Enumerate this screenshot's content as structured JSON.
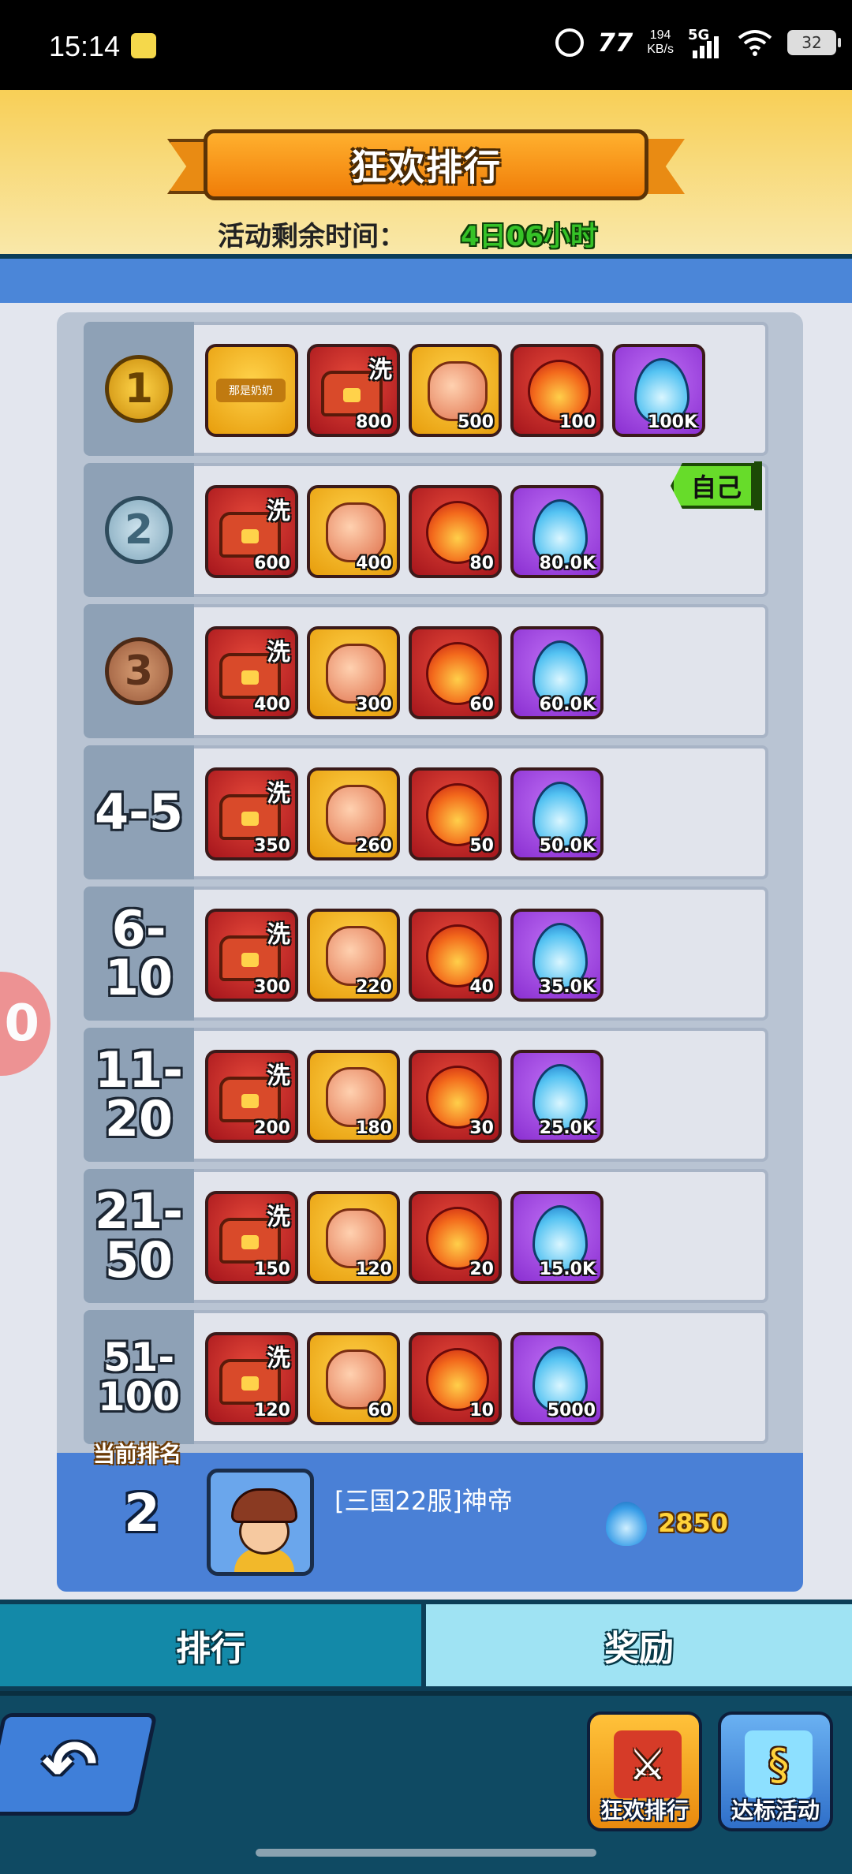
{
  "status_bar": {
    "time": "15:14",
    "network_speed_value": "194",
    "network_speed_unit": "KB/s",
    "network_type": "5G",
    "carrier_mark": "77",
    "battery": "32"
  },
  "header": {
    "title": "狂欢排行",
    "timer_label": "活动剩余时间：",
    "timer_value": "4日06小时"
  },
  "rank_rows": [
    {
      "rank": "1",
      "rank_type": "medal-gold",
      "items": [
        {
          "type": "frame",
          "color": "gold",
          "qty": "",
          "label": "那是奶奶"
        },
        {
          "type": "chest",
          "color": "red",
          "qty": "800",
          "mark": "洗"
        },
        {
          "type": "stone",
          "color": "gold",
          "qty": "500"
        },
        {
          "type": "fireball",
          "color": "red",
          "qty": "100"
        },
        {
          "type": "bluefire",
          "color": "purple",
          "qty": "100K"
        }
      ]
    },
    {
      "rank": "2",
      "rank_type": "medal-silver",
      "items": [
        {
          "type": "chest",
          "color": "red",
          "qty": "600",
          "mark": "洗"
        },
        {
          "type": "stone",
          "color": "gold",
          "qty": "400"
        },
        {
          "type": "fireball",
          "color": "red",
          "qty": "80"
        },
        {
          "type": "bluefire",
          "color": "purple",
          "qty": "80.0K"
        }
      ]
    },
    {
      "rank": "3",
      "rank_type": "medal-bronze",
      "items": [
        {
          "type": "chest",
          "color": "red",
          "qty": "400",
          "mark": "洗"
        },
        {
          "type": "stone",
          "color": "gold",
          "qty": "300"
        },
        {
          "type": "fireball",
          "color": "red",
          "qty": "60"
        },
        {
          "type": "bluefire",
          "color": "purple",
          "qty": "60.0K"
        }
      ]
    },
    {
      "rank": "4-5",
      "rank_type": "text",
      "items": [
        {
          "type": "chest",
          "color": "red",
          "qty": "350",
          "mark": "洗"
        },
        {
          "type": "stone",
          "color": "gold",
          "qty": "260"
        },
        {
          "type": "fireball",
          "color": "red",
          "qty": "50"
        },
        {
          "type": "bluefire",
          "color": "purple",
          "qty": "50.0K"
        }
      ]
    },
    {
      "rank": "6-10",
      "rank_type": "text",
      "items": [
        {
          "type": "chest",
          "color": "red",
          "qty": "300",
          "mark": "洗"
        },
        {
          "type": "stone",
          "color": "gold",
          "qty": "220"
        },
        {
          "type": "fireball",
          "color": "red",
          "qty": "40"
        },
        {
          "type": "bluefire",
          "color": "purple",
          "qty": "35.0K"
        }
      ]
    },
    {
      "rank": "11-20",
      "rank_type": "text",
      "items": [
        {
          "type": "chest",
          "color": "red",
          "qty": "200",
          "mark": "洗"
        },
        {
          "type": "stone",
          "color": "gold",
          "qty": "180"
        },
        {
          "type": "fireball",
          "color": "red",
          "qty": "30"
        },
        {
          "type": "bluefire",
          "color": "purple",
          "qty": "25.0K"
        }
      ]
    },
    {
      "rank": "21-50",
      "rank_type": "text",
      "items": [
        {
          "type": "chest",
          "color": "red",
          "qty": "150",
          "mark": "洗"
        },
        {
          "type": "stone",
          "color": "gold",
          "qty": "120"
        },
        {
          "type": "fireball",
          "color": "red",
          "qty": "20"
        },
        {
          "type": "bluefire",
          "color": "purple",
          "qty": "15.0K"
        }
      ]
    },
    {
      "rank": "51-100",
      "rank_type": "text-small",
      "items": [
        {
          "type": "chest",
          "color": "red",
          "qty": "120",
          "mark": "洗"
        },
        {
          "type": "stone",
          "color": "gold",
          "qty": "60"
        },
        {
          "type": "fireball",
          "color": "red",
          "qty": "10"
        },
        {
          "type": "bluefire",
          "color": "purple",
          "qty": "5000"
        }
      ]
    }
  ],
  "self_tag": "自己",
  "current": {
    "label": "当前排名",
    "rank": "2",
    "player_name": "[三国22服]神帝",
    "score": "2850"
  },
  "tabs": {
    "ranking": "排行",
    "rewards": "奖励"
  },
  "bottom_nav": {
    "carnival_label": "狂欢排行",
    "target_label": "达标活动",
    "back_glyph": "↶"
  },
  "floating_bubble_text": "0"
}
